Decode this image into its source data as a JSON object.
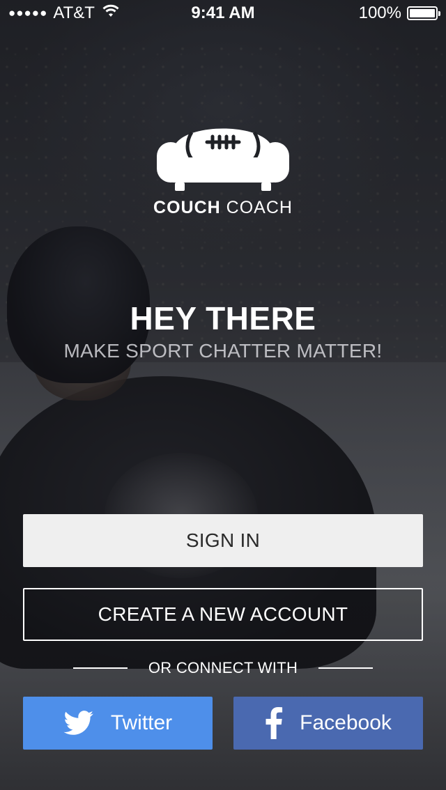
{
  "status_bar": {
    "signal_dots": "●●●●●",
    "carrier": "AT&T",
    "wifi_icon": "wifi-icon",
    "time": "9:41 AM",
    "battery": "100%",
    "battery_level": 1.0
  },
  "brand": {
    "logo_icon": "couch-football-icon",
    "name_bold": "COUCH",
    "name_light": "COACH"
  },
  "hero": {
    "title": "HEY THERE",
    "subtitle": "MAKE SPORT CHATTER MATTER!"
  },
  "actions": {
    "sign_in": "SIGN IN",
    "create_account": "CREATE A NEW ACCOUNT",
    "connect_label": "OR CONNECT WITH"
  },
  "social": {
    "twitter": {
      "label": "Twitter",
      "icon": "twitter-bird-icon",
      "color": "#4e8fea"
    },
    "facebook": {
      "label": "Facebook",
      "icon": "facebook-f-icon",
      "color": "#4a69b0"
    }
  }
}
